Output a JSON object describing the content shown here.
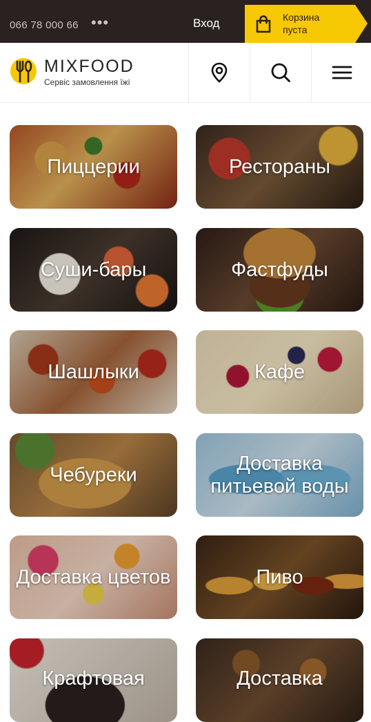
{
  "topbar": {
    "phone": "066 78 000 66",
    "more": "•••",
    "login": "Вход",
    "cart_line1": "Корзина",
    "cart_line2": "пуста"
  },
  "header": {
    "brand": "MIXFOOD",
    "tagline": "Сервіс замовлення їжі"
  },
  "icons": {
    "location": "location-pin-icon",
    "search": "search-icon",
    "menu": "hamburger-menu-icon",
    "cart": "shopping-bag-icon",
    "logo": "fork-spoon-logo-icon"
  },
  "colors": {
    "topbar": "#2a2220",
    "cart_accent": "#f7c804",
    "text_dark": "#222222"
  },
  "categories": [
    {
      "label": "Пиццерии"
    },
    {
      "label": "Рестораны"
    },
    {
      "label": "Суши-бары"
    },
    {
      "label": "Фастфуды"
    },
    {
      "label": "Шашлыки"
    },
    {
      "label": "Кафе"
    },
    {
      "label": "Чебуреки"
    },
    {
      "label": "Доставка питьевой воды"
    },
    {
      "label": "Доставка цветов"
    },
    {
      "label": "Пиво"
    },
    {
      "label": "Крафтовая"
    },
    {
      "label": "Доставка"
    }
  ]
}
